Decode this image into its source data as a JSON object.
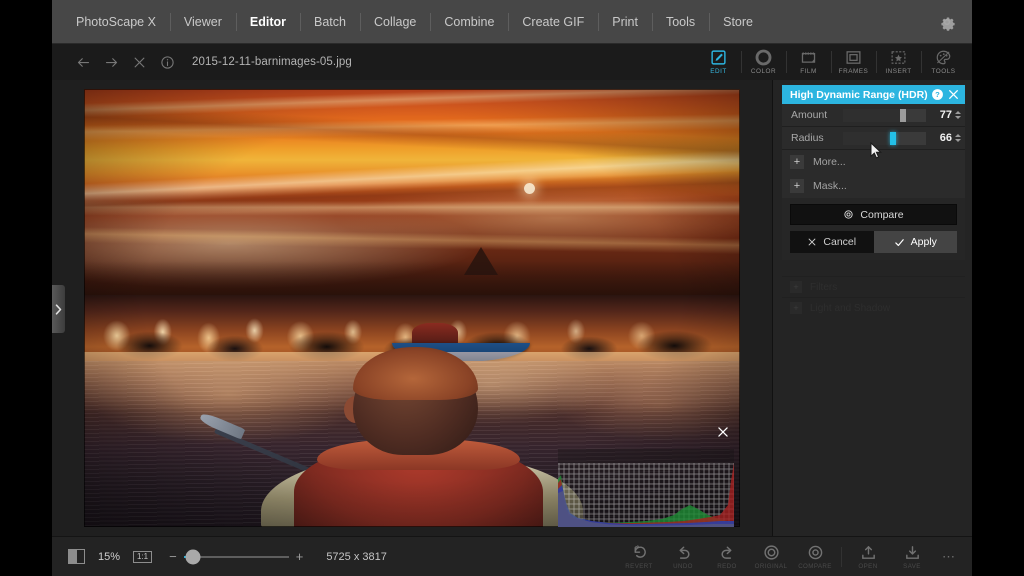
{
  "menubar": {
    "items": [
      {
        "label": "PhotoScape X",
        "active": false
      },
      {
        "label": "Viewer",
        "active": false
      },
      {
        "label": "Editor",
        "active": true
      },
      {
        "label": "Batch",
        "active": false
      },
      {
        "label": "Collage",
        "active": false
      },
      {
        "label": "Combine",
        "active": false
      },
      {
        "label": "Create GIF",
        "active": false
      },
      {
        "label": "Print",
        "active": false
      },
      {
        "label": "Tools",
        "active": false
      },
      {
        "label": "Store",
        "active": false
      }
    ],
    "settings_icon": "gear-icon"
  },
  "navbar": {
    "back_icon": "arrow-left-icon",
    "forward_icon": "arrow-right-icon",
    "close_icon": "close-icon",
    "info_icon": "info-icon",
    "filename": "2015-12-11-barnimages-05.jpg"
  },
  "tool_tabs": [
    {
      "label": "EDIT",
      "icon": "edit-pencil-icon",
      "active": true
    },
    {
      "label": "COLOR",
      "icon": "color-ring-icon",
      "active": false
    },
    {
      "label": "FILM",
      "icon": "film-icon",
      "active": false
    },
    {
      "label": "FRAMES",
      "icon": "frames-icon",
      "active": false
    },
    {
      "label": "INSERT",
      "icon": "insert-star-icon",
      "active": false
    },
    {
      "label": "TOOLS",
      "icon": "tools-palette-icon",
      "active": false
    }
  ],
  "panel": {
    "title": "High Dynamic Range (HDR)",
    "help_icon": "help-question-icon",
    "close_icon": "close-icon",
    "sliders": [
      {
        "label": "Amount",
        "value": "77",
        "percent": 72,
        "active": false
      },
      {
        "label": "Radius",
        "value": "66",
        "percent": 60,
        "active": true
      }
    ],
    "expand_rows": [
      {
        "label": "More...",
        "plus": "+"
      },
      {
        "label": "Mask...",
        "plus": "+"
      }
    ],
    "compare_label": "Compare",
    "compare_icon": "compare-ring-icon",
    "cancel_label": "Cancel",
    "cancel_icon": "close-icon",
    "apply_label": "Apply",
    "apply_icon": "check-icon",
    "accent_color": "#2cb5e0",
    "dim_rows": [
      {
        "label": "Filters",
        "plus": "+"
      },
      {
        "label": "Light and Shadow",
        "plus": "+"
      }
    ]
  },
  "canvas": {
    "collapse_handle_icon": "chevron-right-icon",
    "histogram_close_icon": "close-icon",
    "photo_alt": "sunset-kayaker-photo"
  },
  "bottombar": {
    "split_view_icon": "split-view-icon",
    "zoom_value": "15%",
    "actual_size_label": "1:1",
    "zoom_out": "−",
    "zoom_in": "+",
    "zoom_percent": 9,
    "dimensions": "5725 x 3817",
    "actions": [
      {
        "label": "REVERT",
        "icon": "revert-icon"
      },
      {
        "label": "UNDO",
        "icon": "undo-icon"
      },
      {
        "label": "REDO",
        "icon": "redo-icon"
      },
      {
        "label": "ORIGINAL",
        "icon": "original-ring-icon"
      },
      {
        "label": "COMPARE",
        "icon": "compare-ring-icon"
      },
      {
        "label": "OPEN",
        "icon": "open-upload-icon"
      },
      {
        "label": "SAVE",
        "icon": "save-download-icon"
      }
    ],
    "more_label": "⋯"
  }
}
